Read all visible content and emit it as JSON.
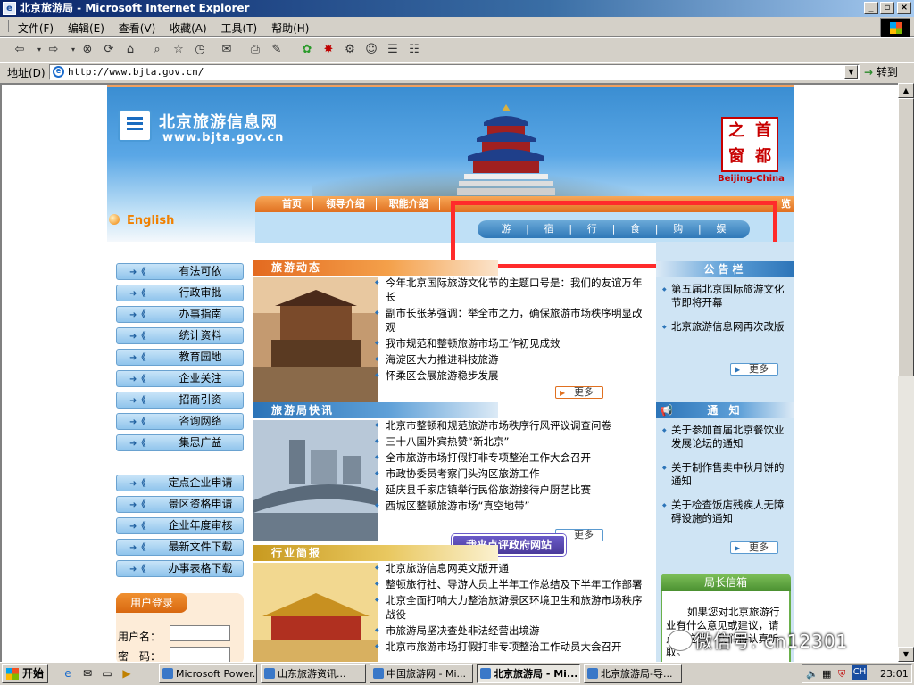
{
  "window": {
    "title": "北京旅游局 - Microsoft Internet Explorer",
    "minimize": "_",
    "restore": "▫",
    "close": "×"
  },
  "menu": {
    "items": [
      "文件(F)",
      "编辑(E)",
      "查看(V)",
      "收藏(A)",
      "工具(T)",
      "帮助(H)"
    ]
  },
  "address": {
    "label": "地址(D)",
    "url": "http://www.bjta.gov.cn/",
    "go_label": "转到"
  },
  "site": {
    "title": "北京旅游信息网",
    "domain": "www.bjta.gov.cn",
    "seal_chars": [
      "首",
      "之",
      "都",
      "窗"
    ],
    "seal_caption": "Beijing-China",
    "english_link": "English",
    "nav": [
      "首页",
      "领导介绍",
      "职能介绍"
    ],
    "nav_tail": "览",
    "categories": [
      "游",
      "|",
      "宿",
      "|",
      "行",
      "|",
      "食",
      "|",
      "购",
      "|",
      "娱"
    ],
    "side_menu_1": [
      "有法可依",
      "行政审批",
      "办事指南",
      "统计资料",
      "教育园地",
      "企业关注",
      "招商引资",
      "咨询网络",
      "集思广益"
    ],
    "side_menu_2": [
      "定点企业申请",
      "景区资格申请",
      "企业年度审核",
      "最新文件下载",
      "办事表格下载"
    ],
    "login": {
      "title": "用户登录",
      "username_label": "用户名：",
      "password_label": "密　码："
    },
    "sections": [
      {
        "title": "旅游动态",
        "items": [
          "今年北京国际旅游文化节的主题口号是：我们的友谊万年长",
          "副市长张茅强调：举全市之力，确保旅游市场秩序明显改观",
          "我市规范和整顿旅游市场工作初见成效",
          "海淀区大力推进科技旅游",
          "怀柔区会展旅游稳步发展"
        ],
        "more": "更多"
      },
      {
        "title": "旅游局快讯",
        "items": [
          "北京市整顿和规范旅游市场秩序行风评议调查问卷",
          "三十八国外宾热赞“新北京”",
          "全市旅游市场打假打非专项整治工作大会召开",
          "市政协委员考察门头沟区旅游工作",
          "延庆县千家店镇举行民俗旅游接待户厨艺比赛",
          "西城区整顿旅游市场“真空地带”"
        ],
        "more": "更多"
      },
      {
        "title": "行业简报",
        "items": [
          "北京旅游信息网英文版开通",
          "整顿旅行社、导游人员上半年工作总结及下半年工作部署",
          "北京全面打响大力整治旅游景区环境卫生和旅游市场秩序战役",
          "市旅游局坚决查处非法经营出境游",
          "北京市旅游市场打假打非专项整治工作动员大会召开"
        ]
      }
    ],
    "eval_badge": "我来点评政府网站",
    "right": {
      "announce_title": "公告栏",
      "announce_items": [
        "第五届北京国际旅游文化节即将开幕",
        "北京旅游信息网再次改版"
      ],
      "notice_title": "通  知",
      "notice_items": [
        "关于参加首届北京餐饮业发展论坛的通知",
        "关于制作售卖中秋月饼的通知",
        "关于检查饭店残疾人无障碍设施的通知"
      ],
      "more": "更多",
      "director_title": "局长信箱",
      "director_text": "如果您对北京旅游行业有什么意见或建议，请点击这里，我们将认真听取。"
    }
  },
  "watermark": "微信号: cn12301",
  "taskbar": {
    "start": "开始",
    "tasks": [
      "Microsoft Power...",
      "山东旅游资讯...",
      "中国旅游网 - Mi...",
      "北京旅游局 - Mi...",
      "北京旅游局-导..."
    ],
    "active_index": 3,
    "ime": "CH",
    "clock": "23:01"
  },
  "colors": {
    "title_gradient_start": "#0a246a",
    "highlight_box": "#ff2b2b",
    "nav_orange": "#e07020",
    "side_blue": "#8fc4ec"
  }
}
